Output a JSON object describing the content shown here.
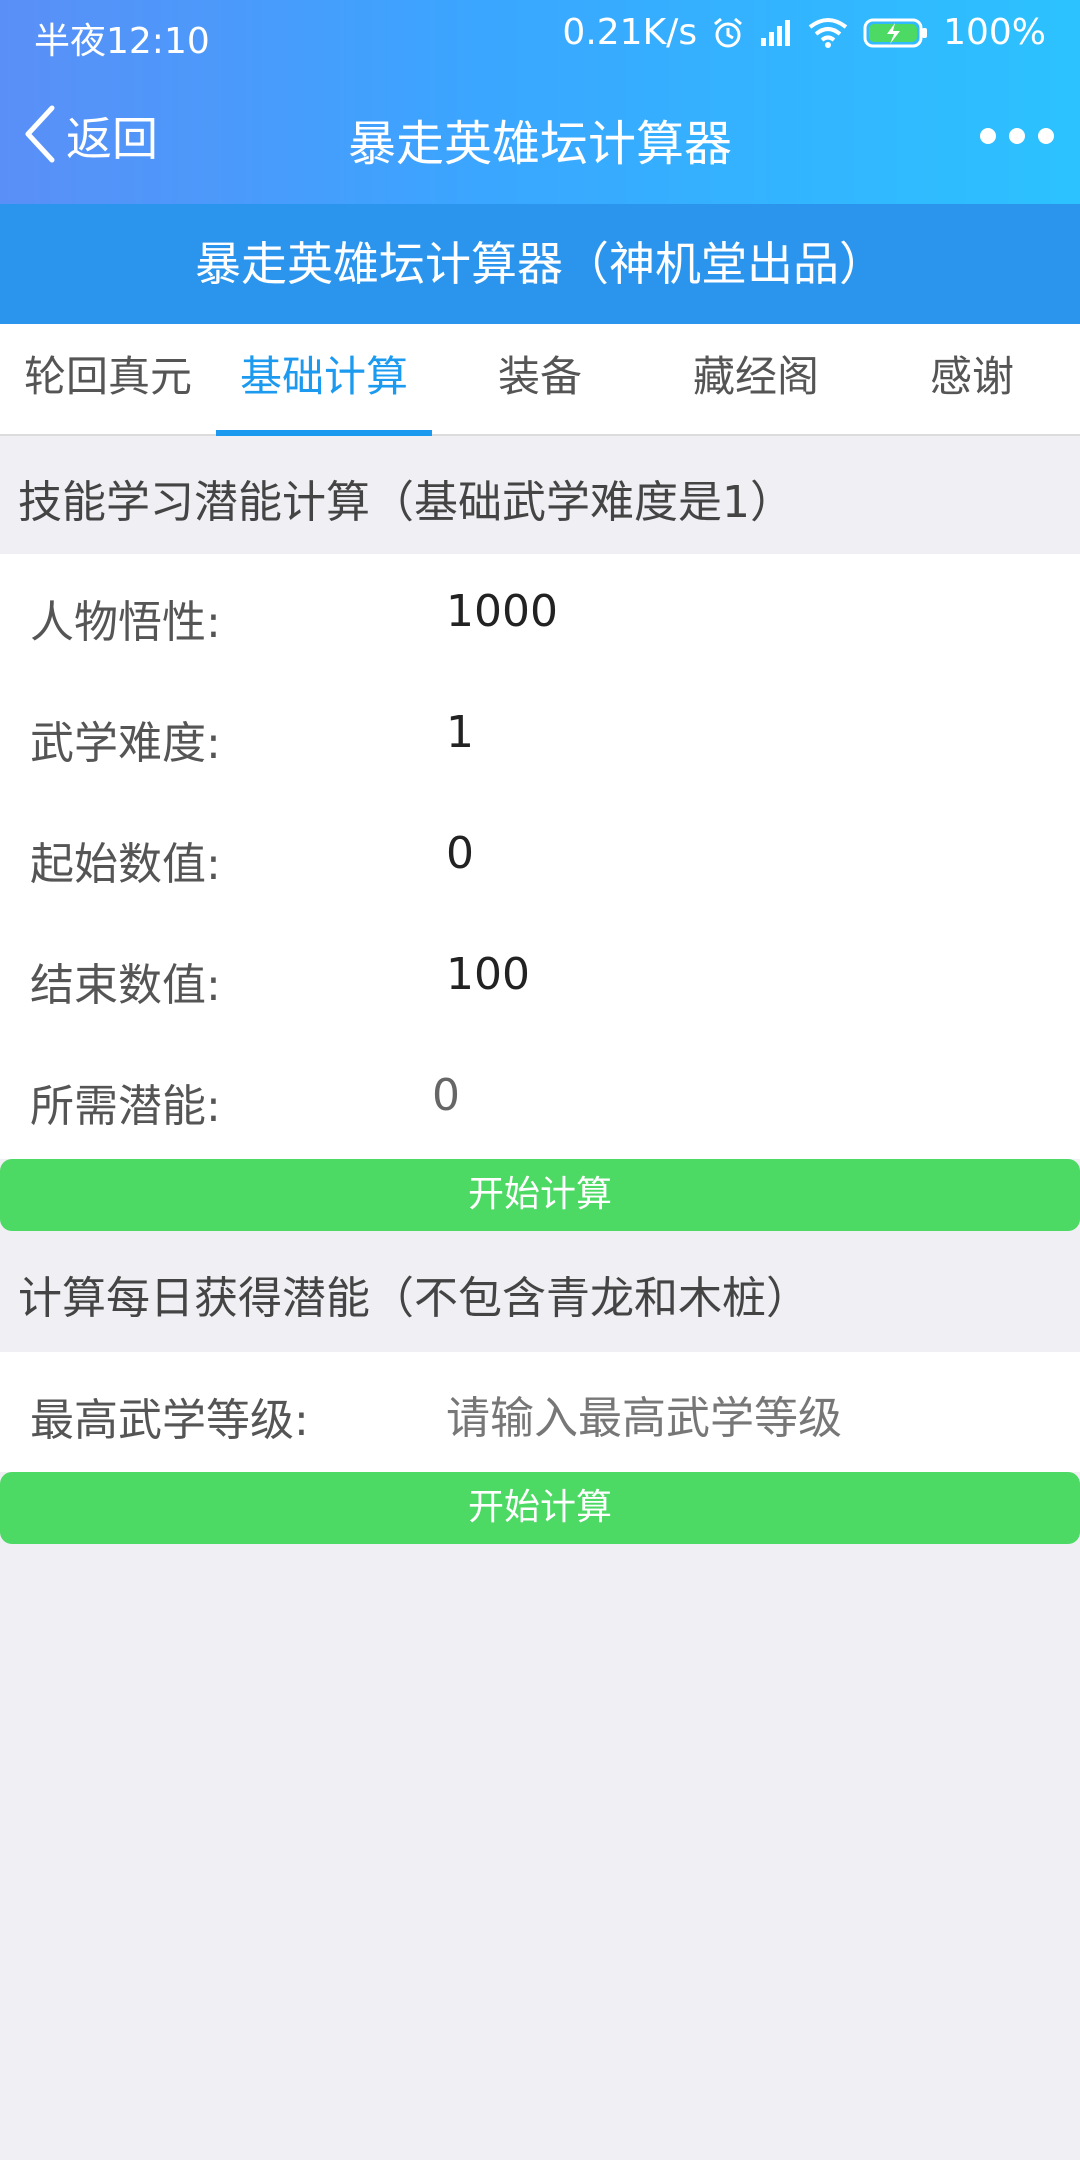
{
  "status_bar": {
    "time": "半夜12:10",
    "net_speed": "0.21K/s",
    "battery": "100%"
  },
  "navbar": {
    "back_label": "返回",
    "title": "暴走英雄坛计算器"
  },
  "banner": {
    "text": "暴走英雄坛计算器（神机堂出品）"
  },
  "tabs": [
    {
      "label": "轮回真元",
      "active": false
    },
    {
      "label": "基础计算",
      "active": true
    },
    {
      "label": "装备",
      "active": false
    },
    {
      "label": "藏经阁",
      "active": false
    },
    {
      "label": "感谢",
      "active": false
    }
  ],
  "section1": {
    "title": "技能学习潜能计算（基础武学难度是1）",
    "fields": [
      {
        "label": "人物悟性:",
        "value": "1000"
      },
      {
        "label": "武学难度:",
        "value": "1"
      },
      {
        "label": "起始数值:",
        "value": "0"
      },
      {
        "label": "结束数值:",
        "value": "100"
      },
      {
        "label": "所需潜能:",
        "value": "0"
      }
    ],
    "button_label": "开始计算"
  },
  "section2": {
    "title": "计算每日获得潜能（不包含青龙和木桩）",
    "field_label": "最高武学等级:",
    "field_placeholder": "请输入最高武学等级",
    "button_label": "开始计算"
  },
  "colors": {
    "accent": "#1c9af0",
    "banner": "#2b95ee",
    "button": "#4cd964",
    "background": "#efeff4"
  },
  "icons": [
    "chevron-left-icon",
    "more-dots-icon",
    "alarm-icon",
    "signal-icon",
    "wifi-icon",
    "battery-icon"
  ]
}
